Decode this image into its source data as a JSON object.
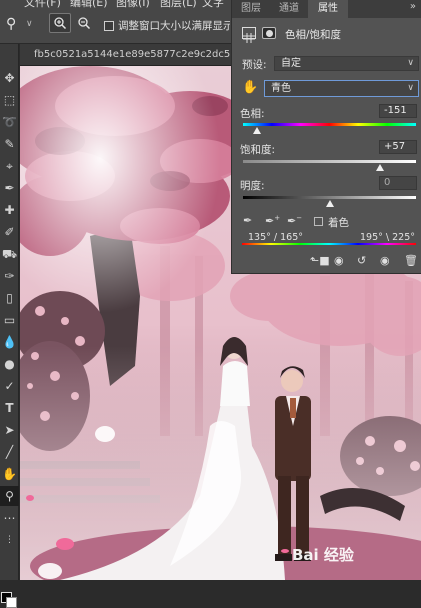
{
  "menu": {
    "items": [
      "文件(F)",
      "编辑(E)",
      "图像(I)",
      "图层(L)",
      "文字(Y)"
    ]
  },
  "options_bar": {
    "zoom_in_label": "+",
    "zoom_out_label": "−",
    "checkbox_label": "调整窗口大小以满屏显示",
    "checkbox_checked": false
  },
  "document": {
    "tab_label": "fb5c0521a5144e1e89e5877c2e9c2dc5.jpg"
  },
  "panel": {
    "tabs": [
      "图层",
      "通道",
      "属性"
    ],
    "active_tab": "属性",
    "collapse_label": "»",
    "title": "色相/饱和度",
    "preset_label": "预设:",
    "preset_value": "自定",
    "range_value": "青色",
    "hue": {
      "label": "色相:",
      "value": "-151",
      "fraction": 0.08
    },
    "saturation": {
      "label": "饱和度:",
      "value": "+57",
      "fraction": 0.79
    },
    "lightness": {
      "label": "明度:",
      "value": "0",
      "fraction": 0.5
    },
    "colorize_label": "着色",
    "range_left": "135° / 165°",
    "range_right": "195° \\ 225°"
  },
  "watermark": {
    "text": "Bai 经验"
  },
  "colors": {
    "panel_bg": "#535353",
    "focus_border": "#6f9ad8",
    "canvas_tint": "#d7a8b4"
  }
}
